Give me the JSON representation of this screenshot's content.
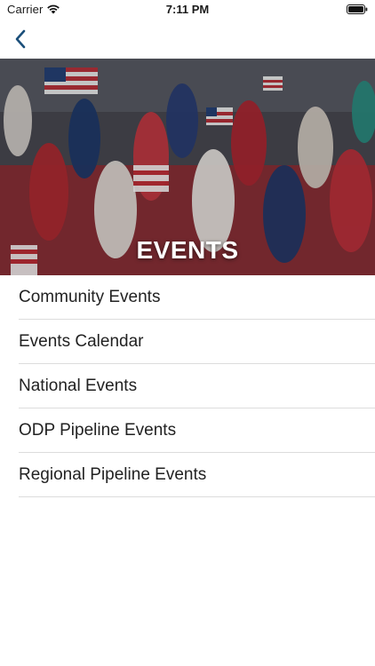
{
  "status_bar": {
    "carrier": "Carrier",
    "time": "7:11 PM"
  },
  "nav": {
    "back_icon": "chevron-left-icon",
    "accent_color": "#1b4f7a"
  },
  "hero": {
    "title": "EVENTS"
  },
  "menu": {
    "items": [
      {
        "label": "Community Events"
      },
      {
        "label": "Events Calendar"
      },
      {
        "label": "National Events"
      },
      {
        "label": "ODP Pipeline Events"
      },
      {
        "label": "Regional Pipeline Events"
      }
    ]
  }
}
